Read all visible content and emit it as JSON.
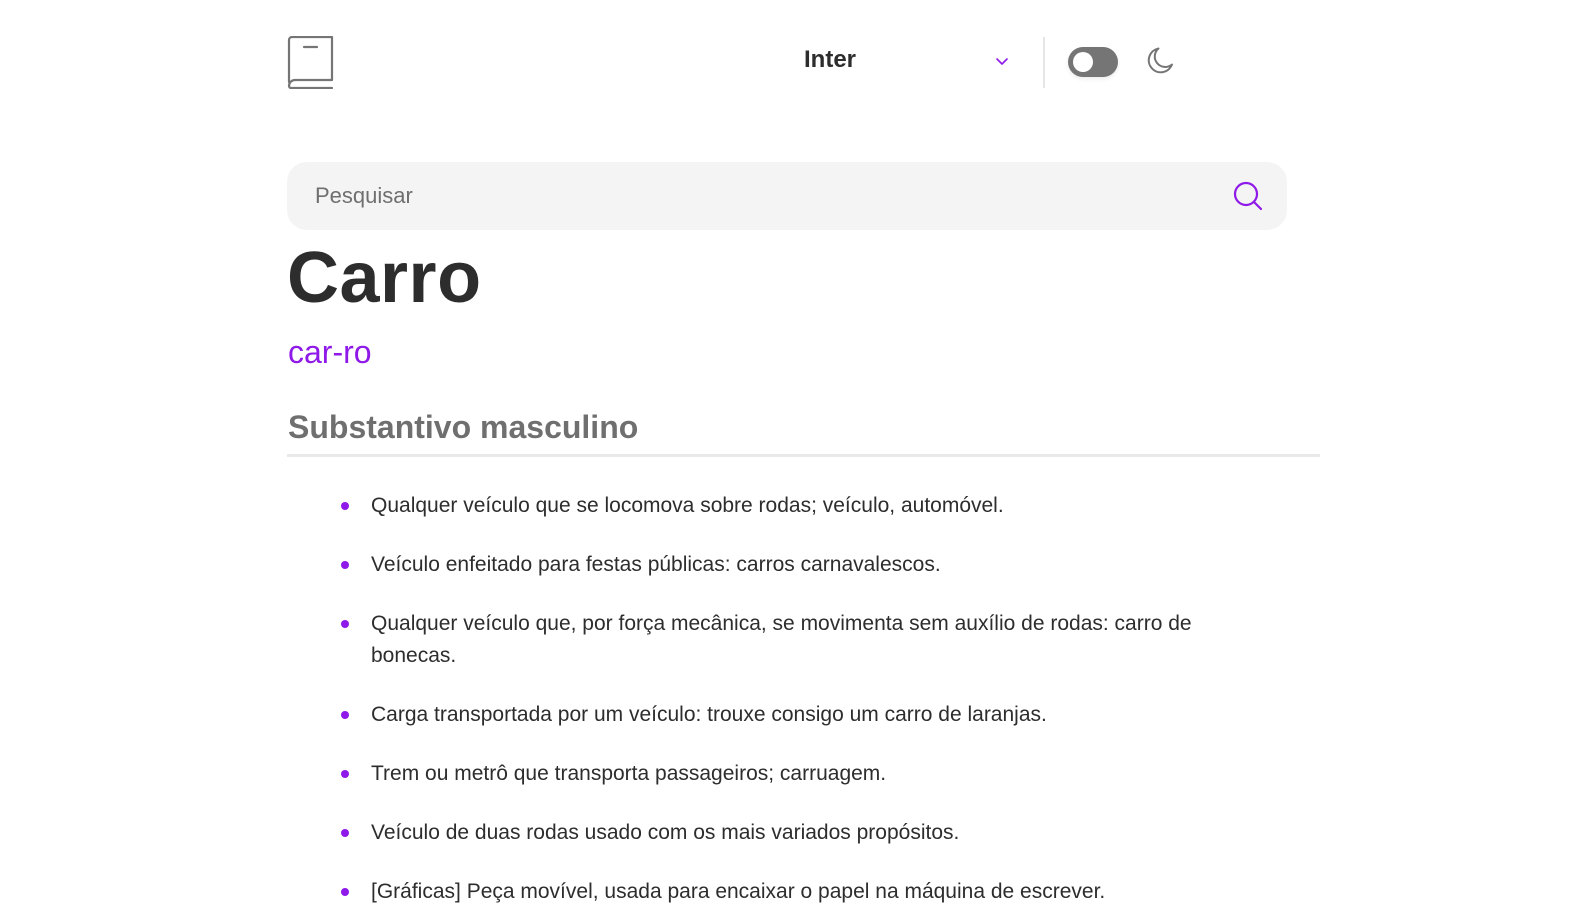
{
  "header": {
    "font_selected": "Inter",
    "theme_toggle_state": "off"
  },
  "search": {
    "placeholder": "Pesquisar",
    "value": ""
  },
  "entry": {
    "word": "Carro",
    "phonetic": "car-ro",
    "part_of_speech": "Substantivo masculino",
    "definitions": [
      "Qualquer veículo que se locomova sobre rodas; veículo, automóvel.",
      "Veículo enfeitado para festas públicas: carros carnavalescos.",
      "Qualquer veículo que, por força mecânica, se movimenta sem auxílio de rodas: carro de bonecas.",
      "Carga transportada por um veículo: trouxe consigo um carro de laranjas.",
      "Trem ou metrô que transporta passageiros; carruagem.",
      "Veículo de duas rodas usado com os mais variados propósitos.",
      "[Gráficas] Peça movível, usada para encaixar o papel na máquina de escrever."
    ]
  },
  "colors": {
    "accent": "#8f19e8",
    "text": "#2d2d2d",
    "muted": "#6f6f6f",
    "search_bg": "#f4f4f4",
    "toggle_bg": "#757575"
  },
  "icons": {
    "logo": "book-icon",
    "font_dropdown": "chevron-down-icon",
    "theme": "moon-icon",
    "search": "search-icon"
  }
}
